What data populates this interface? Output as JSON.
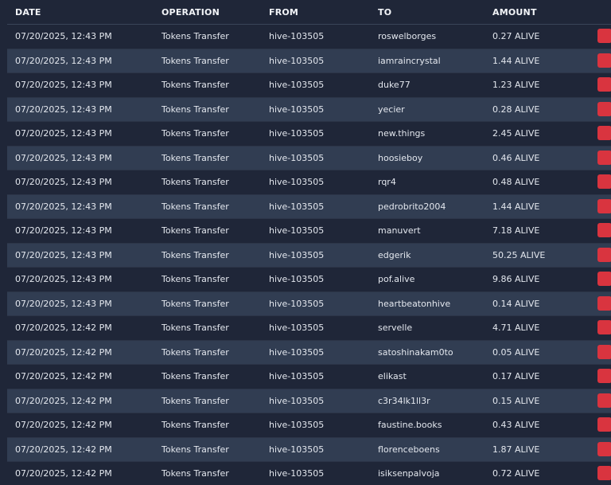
{
  "table": {
    "headers": [
      "DATE",
      "OPERATION",
      "FROM",
      "TO",
      "AMOUNT"
    ],
    "action_icon": "details-icon",
    "action_color": "#d9343f",
    "rows": [
      {
        "date": "07/20/2025, 12:43 PM",
        "operation": "Tokens Transfer",
        "from": "hive-103505",
        "to": "roswelborges",
        "amount": "0.27 ALIVE"
      },
      {
        "date": "07/20/2025, 12:43 PM",
        "operation": "Tokens Transfer",
        "from": "hive-103505",
        "to": "iamraincrystal",
        "amount": "1.44 ALIVE"
      },
      {
        "date": "07/20/2025, 12:43 PM",
        "operation": "Tokens Transfer",
        "from": "hive-103505",
        "to": "duke77",
        "amount": "1.23 ALIVE"
      },
      {
        "date": "07/20/2025, 12:43 PM",
        "operation": "Tokens Transfer",
        "from": "hive-103505",
        "to": "yecier",
        "amount": "0.28 ALIVE"
      },
      {
        "date": "07/20/2025, 12:43 PM",
        "operation": "Tokens Transfer",
        "from": "hive-103505",
        "to": "new.things",
        "amount": "2.45 ALIVE"
      },
      {
        "date": "07/20/2025, 12:43 PM",
        "operation": "Tokens Transfer",
        "from": "hive-103505",
        "to": "hoosieboy",
        "amount": "0.46 ALIVE"
      },
      {
        "date": "07/20/2025, 12:43 PM",
        "operation": "Tokens Transfer",
        "from": "hive-103505",
        "to": "rqr4",
        "amount": "0.48 ALIVE"
      },
      {
        "date": "07/20/2025, 12:43 PM",
        "operation": "Tokens Transfer",
        "from": "hive-103505",
        "to": "pedrobrito2004",
        "amount": "1.44 ALIVE"
      },
      {
        "date": "07/20/2025, 12:43 PM",
        "operation": "Tokens Transfer",
        "from": "hive-103505",
        "to": "manuvert",
        "amount": "7.18 ALIVE"
      },
      {
        "date": "07/20/2025, 12:43 PM",
        "operation": "Tokens Transfer",
        "from": "hive-103505",
        "to": "edgerik",
        "amount": "50.25 ALIVE"
      },
      {
        "date": "07/20/2025, 12:43 PM",
        "operation": "Tokens Transfer",
        "from": "hive-103505",
        "to": "pof.alive",
        "amount": "9.86 ALIVE"
      },
      {
        "date": "07/20/2025, 12:43 PM",
        "operation": "Tokens Transfer",
        "from": "hive-103505",
        "to": "heartbeatonhive",
        "amount": "0.14 ALIVE"
      },
      {
        "date": "07/20/2025, 12:42 PM",
        "operation": "Tokens Transfer",
        "from": "hive-103505",
        "to": "servelle",
        "amount": "4.71 ALIVE"
      },
      {
        "date": "07/20/2025, 12:42 PM",
        "operation": "Tokens Transfer",
        "from": "hive-103505",
        "to": "satoshinakam0to",
        "amount": "0.05 ALIVE"
      },
      {
        "date": "07/20/2025, 12:42 PM",
        "operation": "Tokens Transfer",
        "from": "hive-103505",
        "to": "elikast",
        "amount": "0.17 ALIVE"
      },
      {
        "date": "07/20/2025, 12:42 PM",
        "operation": "Tokens Transfer",
        "from": "hive-103505",
        "to": "c3r34lk1ll3r",
        "amount": "0.15 ALIVE"
      },
      {
        "date": "07/20/2025, 12:42 PM",
        "operation": "Tokens Transfer",
        "from": "hive-103505",
        "to": "faustine.books",
        "amount": "0.43 ALIVE"
      },
      {
        "date": "07/20/2025, 12:42 PM",
        "operation": "Tokens Transfer",
        "from": "hive-103505",
        "to": "florenceboens",
        "amount": "1.87 ALIVE"
      },
      {
        "date": "07/20/2025, 12:42 PM",
        "operation": "Tokens Transfer",
        "from": "hive-103505",
        "to": "isiksenpalvoja",
        "amount": "0.72 ALIVE"
      }
    ]
  }
}
